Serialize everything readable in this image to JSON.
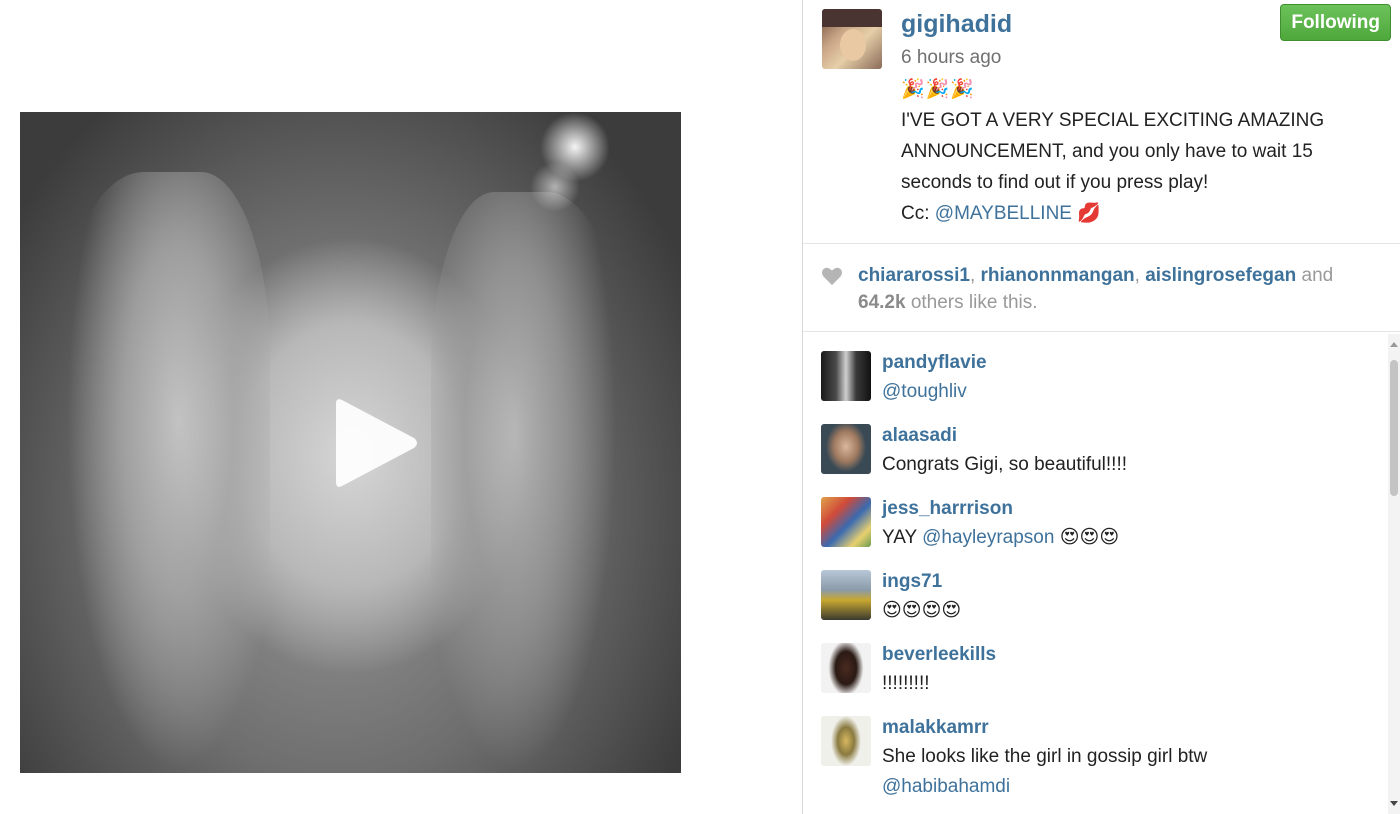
{
  "post": {
    "username": "gigihadid",
    "time_ago": "6 hours ago",
    "follow_label": "Following",
    "caption_emoji": "🎉🎉🎉",
    "caption_text": "I'VE GOT A VERY SPECIAL EXCITING AMAZING ANNOUNCEMENT, and you only have to wait 15 seconds to find out if you press play!",
    "caption_cc_prefix": "Cc: ",
    "caption_cc_mention": "@MAYBELLINE",
    "caption_cc_emoji": "💋"
  },
  "likes": {
    "likers": [
      "chiararossi1",
      "rhianonnmangan",
      "aislingrosefegan"
    ],
    "and_word": " and",
    "count": "64.2k",
    "suffix": " others like this."
  },
  "comments": [
    {
      "user": "pandyflavie",
      "mention": "@toughliv",
      "text": ""
    },
    {
      "user": "alaasadi",
      "mention": "",
      "text": "Congrats Gigi, so beautiful!!!!"
    },
    {
      "user": "jess_harrrison",
      "text_prefix": "YAY ",
      "mention": "@hayleyrapson",
      "text_suffix": " 😍😍😍"
    },
    {
      "user": "ings71",
      "mention": "",
      "text": "😍😍😍😍"
    },
    {
      "user": "beverleekills",
      "mention": "",
      "text": "!!!!!!!!!"
    },
    {
      "user": "malakkamrr",
      "text": "She looks like the girl in gossip girl btw",
      "mention": "@habibahamdi"
    }
  ],
  "colors": {
    "link_blue": "#3f729b",
    "follow_green": "#4fa83c",
    "muted_text": "#999999"
  },
  "icons": {
    "play": "play-icon",
    "heart": "heart-icon"
  }
}
